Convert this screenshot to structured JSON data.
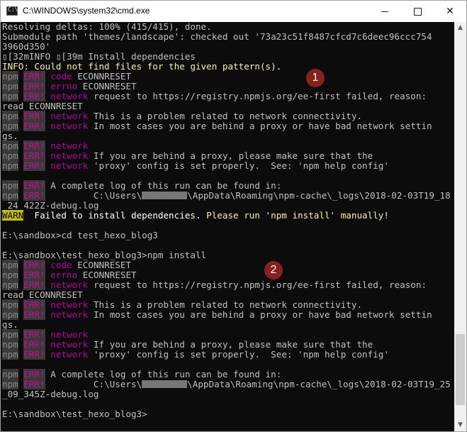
{
  "window": {
    "title": "C:\\WINDOWS\\system32\\cmd.exe",
    "icon": "cmd-icon"
  },
  "badges": {
    "one": "1",
    "two": "2"
  },
  "lines": {
    "l0": "Resolving deltas: 100% (415/415), done.",
    "l1": "Submodule path 'themes/landscape': checked out '73a23c51f8487cfcd7c6deec96ccc754",
    "l2": "3960d350'",
    "l3": "▯[32mINFO ▯[39m Install dependencies",
    "l4": "INFO: Could not find files for the given pattern(s).",
    "npm": "npm",
    "err": "ERR!",
    "code": "code",
    "errno": "errno",
    "network": "network",
    "econn": " ECONNRESET",
    "request": " request to https://registry.npmjs.org/ee-first failed, reason:",
    "read": "read ECONNRESET",
    "prob": " This is a problem related to network connectivity.",
    "most": " In most cases you are behind a proxy or have bad network settin",
    "gs": "gs.",
    "ifbehind": " If you are behind a proxy, please make sure that the",
    "proxycfg": " 'proxy' config is set properly.  See: 'npm help config'",
    "complete": " A complete log of this run can be found in:",
    "path_pre": "         C:\\Users\\",
    "path_post1": "\\AppData\\Roaming\\npm-cache\\_logs\\2018-02-03T19_18",
    "path_tail1": "_24_422Z-debug.log",
    "path_post2": "\\AppData\\Roaming\\npm-cache\\_logs\\2018-02-03T19_25",
    "path_tail2": "_09_345Z-debug.log",
    "warn": "WARN",
    "warn_msg1": "  Failed to install dependencies.",
    "warn_msg2": " Please run 'npm install' manually!",
    "cmd1": "E:\\sandbox>cd test_hexo_blog3",
    "cmd2": "E:\\sandbox\\test_hexo_blog3>npm install",
    "prompt": "E:\\sandbox\\test_hexo_blog3>"
  }
}
